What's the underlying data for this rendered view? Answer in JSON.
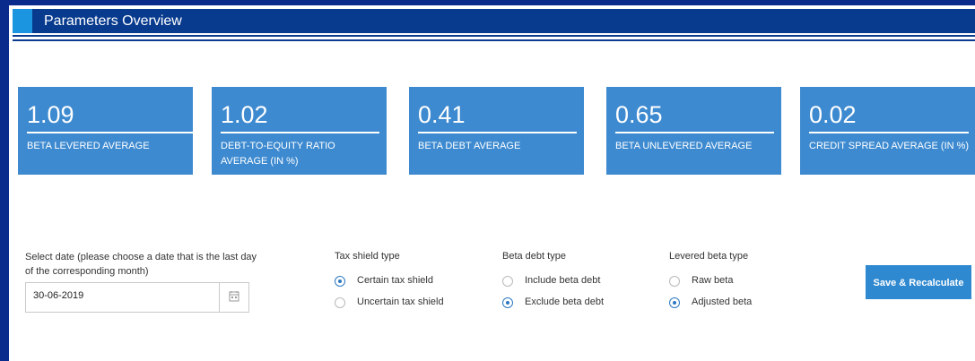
{
  "header": {
    "title": "Parameters Overview"
  },
  "cards": [
    {
      "value": "1.09",
      "label": "BETA LEVERED AVERAGE"
    },
    {
      "value": "1.02",
      "label": "DEBT-TO-EQUITY RATIO AVERAGE (IN %)"
    },
    {
      "value": "0.41",
      "label": "BETA DEBT AVERAGE"
    },
    {
      "value": "0.65",
      "label": "BETA UNLEVERED AVERAGE"
    },
    {
      "value": "0.02",
      "label": "CREDIT SPREAD AVERAGE (IN %)"
    }
  ],
  "date": {
    "label": "Select date (please choose a date that is the last day of the corresponding month)",
    "value": "30-06-2019",
    "icon": "calendar-icon"
  },
  "tax_shield": {
    "title": "Tax shield type",
    "options": [
      "Certain tax shield",
      "Uncertain tax shield"
    ],
    "selected": "Certain tax shield"
  },
  "beta_debt": {
    "title": "Beta debt type",
    "options": [
      "Include beta debt",
      "Exclude beta debt"
    ],
    "selected": "Exclude beta debt"
  },
  "levered_beta": {
    "title": "Levered beta type",
    "options": [
      "Raw beta",
      "Adjusted beta"
    ],
    "selected": "Adjusted beta"
  },
  "actions": {
    "save": "Save & Recalculate"
  },
  "colors": {
    "header": "#083b8e",
    "accent": "#1b95e0",
    "card": "#3d8ad0",
    "button": "#2f89d0",
    "frame": "#0a2a8c"
  }
}
